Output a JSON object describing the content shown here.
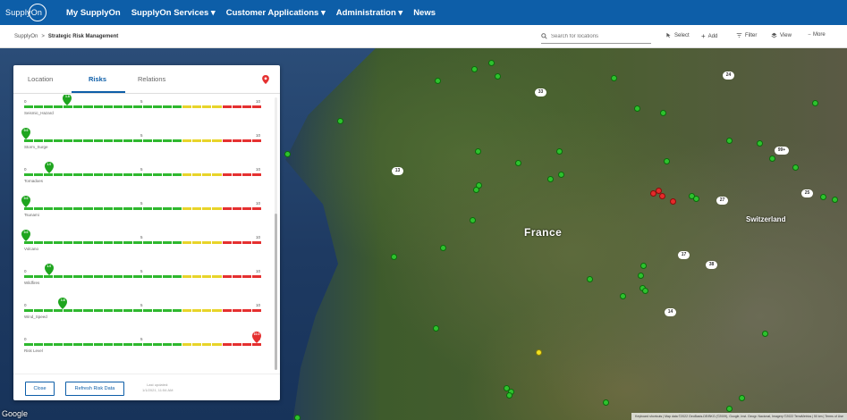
{
  "nav": {
    "logo_text": "SupplyOn",
    "items": [
      {
        "label": "My SupplyOn"
      },
      {
        "label": "SupplyOn Services ▾"
      },
      {
        "label": "Customer Applications ▾"
      },
      {
        "label": "Administration ▾"
      },
      {
        "label": "News"
      }
    ]
  },
  "breadcrumb": {
    "root": "SupplyOn",
    "separator": ">",
    "current": "Strategic Risk Management"
  },
  "search": {
    "placeholder": "Search for locations"
  },
  "toolbar": {
    "select": "Select",
    "add": "Add",
    "filter": "Filter",
    "view": "View",
    "more": "More"
  },
  "map": {
    "country_label": "France",
    "neighbor_label": "Switzerland",
    "google_label": "Google",
    "attribution": "Keyboard shortcuts | Map data ©2022 GeoBasis-DE/BKG (©2009), Google, Inst. Geogr. Nacional, Imagery ©2022 TerraMetrics | 50 km | Terms of Use",
    "road_labels": [
      "33",
      "13",
      "24",
      "99+",
      "27",
      "17",
      "38",
      "14",
      "25"
    ]
  },
  "panel": {
    "tabs": [
      {
        "label": "Location",
        "active": false
      },
      {
        "label": "Risks",
        "active": true
      },
      {
        "label": "Relations",
        "active": false
      }
    ],
    "scale_labels": {
      "min": "0",
      "mid": "5",
      "max": "10"
    },
    "risks": [
      {
        "label": "Seismic_Hazard",
        "value": "1.8",
        "fraction": 0.18,
        "status": "green"
      },
      {
        "label": "Storm_Surge",
        "value": "0.0",
        "fraction": 0.0,
        "status": "green"
      },
      {
        "label": "Tornadoes",
        "value": "1.0",
        "fraction": 0.1,
        "status": "green"
      },
      {
        "label": "Tsunami",
        "value": "0.0",
        "fraction": 0.0,
        "status": "green"
      },
      {
        "label": "Volcano",
        "value": "0.0",
        "fraction": 0.0,
        "status": "green"
      },
      {
        "label": "Wildfires",
        "value": "1.0",
        "fraction": 0.1,
        "status": "green"
      },
      {
        "label": "Wind_Speed",
        "value": "1.6",
        "fraction": 0.16,
        "status": "green"
      },
      {
        "label": "Risk Level",
        "value": "10.0",
        "fraction": 1.0,
        "status": "red"
      }
    ],
    "close_label": "Close",
    "refresh_label": "Refresh Risk Data",
    "last_updated_label": "Last updated:",
    "last_updated_value": "1/1/2021, 11:54 AM"
  },
  "colors": {
    "brand": "#0d5ea8",
    "green": "#2eb82e",
    "yellow": "#e8d42a",
    "red": "#e53030"
  }
}
